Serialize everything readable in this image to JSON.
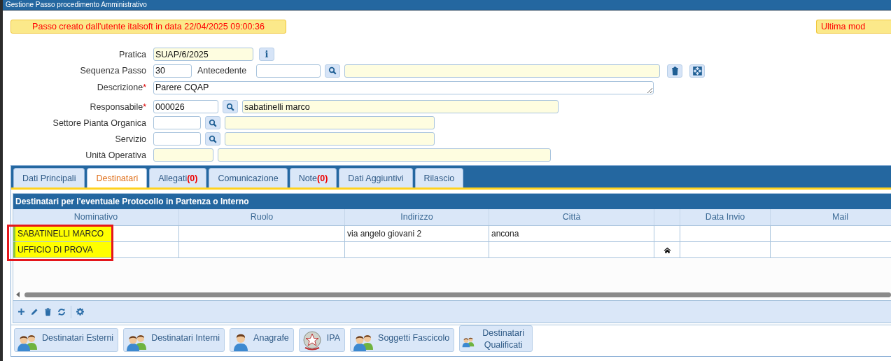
{
  "window": {
    "title": "Gestione Passo procedimento Amministrativo"
  },
  "banners": [
    {
      "text": "Passo creato dall'utente italsoft in data 22/04/2025 09:00:36"
    },
    {
      "text": "Ultima mod"
    }
  ],
  "form": [
    {
      "label": "Pratica",
      "fields": [
        {
          "kind": "readonly",
          "value": "SUAP/6/2025"
        },
        {
          "kind": "info",
          "text": "i"
        }
      ]
    },
    {
      "label": "Sequenza Passo",
      "fields": [
        {
          "kind": "input",
          "value": "30"
        },
        {
          "kind": "label",
          "text": "Antecedente"
        },
        {
          "kind": "input"
        },
        {
          "kind": "search"
        },
        {
          "kind": "readonly"
        },
        {
          "kind": "trash"
        },
        {
          "kind": "expand"
        }
      ]
    },
    {
      "label": "Descrizione",
      "required_mark": "*",
      "fields": [
        {
          "kind": "textarea",
          "value": "Parere CQAP"
        }
      ]
    },
    {
      "label": "Responsabile",
      "required_mark": "*",
      "fields": [
        {
          "kind": "input",
          "value": "000026"
        },
        {
          "kind": "search"
        },
        {
          "kind": "readonly",
          "value": "sabatinelli marco"
        }
      ]
    },
    {
      "label": "Settore Pianta Organica",
      "fields": [
        {
          "kind": "input"
        },
        {
          "kind": "search"
        },
        {
          "kind": "readonly"
        }
      ]
    },
    {
      "label": "Servizio",
      "fields": [
        {
          "kind": "input"
        },
        {
          "kind": "search"
        },
        {
          "kind": "readonly"
        }
      ]
    },
    {
      "label": "Unità Operativa",
      "fields": [
        {
          "kind": "readonly"
        },
        {
          "kind": "readonly"
        }
      ]
    }
  ],
  "tabs": [
    {
      "label": "Dati Principali",
      "selected": false
    },
    {
      "label": "Destinatari",
      "selected": true
    },
    {
      "label": "Allegati",
      "count": "(0)",
      "selected": false
    },
    {
      "label": "Comunicazione",
      "selected": false
    },
    {
      "label": "Note",
      "count": "(0)",
      "selected": false
    },
    {
      "label": "Dati Aggiuntivi",
      "selected": false
    },
    {
      "label": "Rilascio",
      "selected": false
    }
  ],
  "grid": {
    "title": "Destinatari per l'eventuale Protocollo in Partenza o Interno",
    "columns": [
      {
        "label": "Nominativo"
      },
      {
        "label": "Ruolo"
      },
      {
        "label": "Indirizzo"
      },
      {
        "label": "Città"
      },
      {},
      {
        "label": "Data Invio"
      },
      {
        "label": "Mail"
      }
    ],
    "rows": [
      {
        "nominativo": "SABATINELLI MARCO",
        "indirizzo": "via angelo giovani 2",
        "citta": "ancona",
        "home": false,
        "highlighted": true
      },
      {
        "nominativo": "UFFICIO DI PROVA",
        "home": true,
        "highlighted": true
      }
    ]
  },
  "buttons": [
    {
      "label": "Destinatari Esterni"
    },
    {
      "label": "Destinatari Interni"
    },
    {
      "label": "Anagrafe"
    },
    {
      "label": "IPA"
    },
    {
      "label": "Soggetti Fascicolo"
    },
    {
      "label": "Destinatari Qualificati"
    }
  ]
}
